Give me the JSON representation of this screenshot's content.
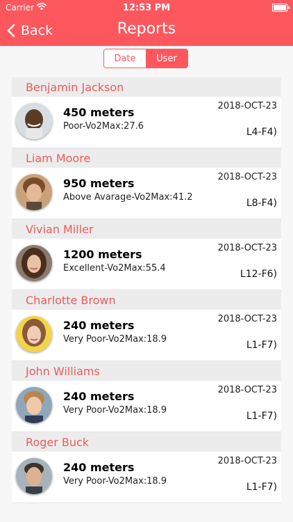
{
  "status_bar": {
    "carrier": "Carrier",
    "time": "12:53 PM"
  },
  "nav": {
    "back_label": "Back",
    "title": "Reports"
  },
  "segments": [
    {
      "label": "Date",
      "selected": false
    },
    {
      "label": "User",
      "selected": true
    }
  ],
  "colors": {
    "accent": "#fd575e",
    "header_text": "#ef5a5a"
  },
  "reports": [
    {
      "name": "Benjamin Jackson",
      "distance": "450 meters",
      "detail": "Poor-Vo2Max:27.6",
      "date": "2018-OCT-23",
      "level": "L4-F4)",
      "avatar": "avatar-benjamin"
    },
    {
      "name": "Liam Moore",
      "distance": "950 meters",
      "detail": "Above Avarage-Vo2Max:41.2",
      "date": "2018-OCT-23",
      "level": "L8-F4)",
      "avatar": "avatar-liam"
    },
    {
      "name": "Vivian Miller",
      "distance": "1200 meters",
      "detail": "Excellent-Vo2Max:55.4",
      "date": "2018-OCT-23",
      "level": "L12-F6)",
      "avatar": "avatar-vivian"
    },
    {
      "name": "Charlotte Brown",
      "distance": "240 meters",
      "detail": "Very Poor-Vo2Max:18.9",
      "date": "2018-OCT-23",
      "level": "L1-F7)",
      "avatar": "avatar-charlotte"
    },
    {
      "name": "John Williams",
      "distance": "240 meters",
      "detail": "Very Poor-Vo2Max:18.9",
      "date": "2018-OCT-23",
      "level": "L1-F7)",
      "avatar": "avatar-john"
    },
    {
      "name": "Roger Buck",
      "distance": "240 meters",
      "detail": "Very Poor-Vo2Max:18.9",
      "date": "2018-OCT-23",
      "level": "L1-F7)",
      "avatar": "avatar-roger"
    }
  ]
}
